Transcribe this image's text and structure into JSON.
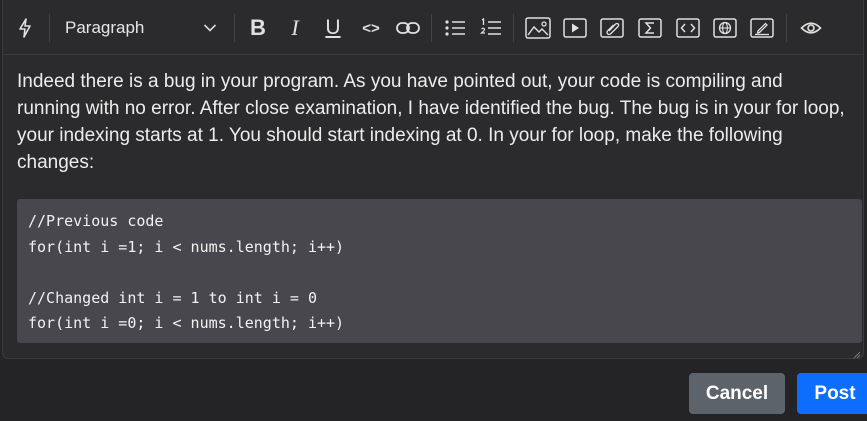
{
  "toolbar": {
    "block_format": "Paragraph",
    "bold_glyph": "B",
    "italic_glyph": "I",
    "underline_glyph": "U",
    "code_glyph": "<>"
  },
  "content": {
    "paragraph": "Indeed there is a bug in your program. As you have pointed out, your code is compiling and running with no error. After close examination, I have identified the bug. The bug is in your for loop, your indexing starts at 1. You should start indexing at 0. In your for loop, make the following changes:",
    "code_lines": [
      "//Previous code",
      "for(int i =1; i < nums.length; i++)",
      "",
      "//Changed int i = 1 to int i = 0",
      "for(int i =0; i < nums.length; i++)"
    ]
  },
  "actions": {
    "cancel_label": "Cancel",
    "post_label": "Post"
  },
  "colors": {
    "page_bg": "#242426",
    "editor_bg": "#2b2b2d",
    "code_bg": "#48474d",
    "cancel_bg": "#5c636a",
    "post_bg": "#0d6efd"
  }
}
